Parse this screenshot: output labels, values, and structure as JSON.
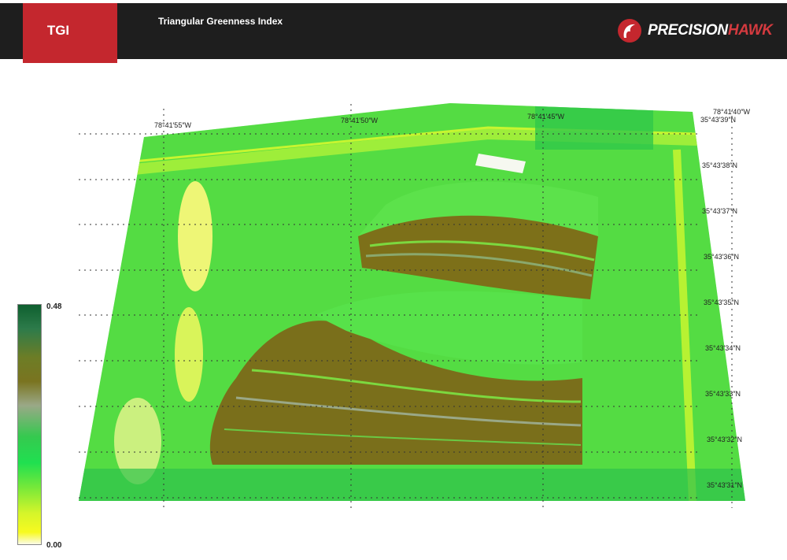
{
  "header": {
    "tag": "TGI",
    "title": "Triangular Greenness Index",
    "logo": {
      "text_main": "PRECISION",
      "text_accent": "HAWK",
      "icon": "precisionhawk-logo-icon",
      "accent_color": "#c4272e"
    }
  },
  "map": {
    "longitude_labels": [
      "78°41′55″W",
      "78°41′50″W",
      "78°41′45″W",
      "78°41′40″W"
    ],
    "latitude_labels": [
      "35°43′39″N",
      "35°43′38″N",
      "35°43′37″N",
      "35°43′36″N",
      "35°43′35″N",
      "35°43′34″N",
      "35°43′33″N",
      "35°43′32″N",
      "35°43′31″N"
    ]
  },
  "legend": {
    "max": "0.48",
    "min": "0.00"
  }
}
